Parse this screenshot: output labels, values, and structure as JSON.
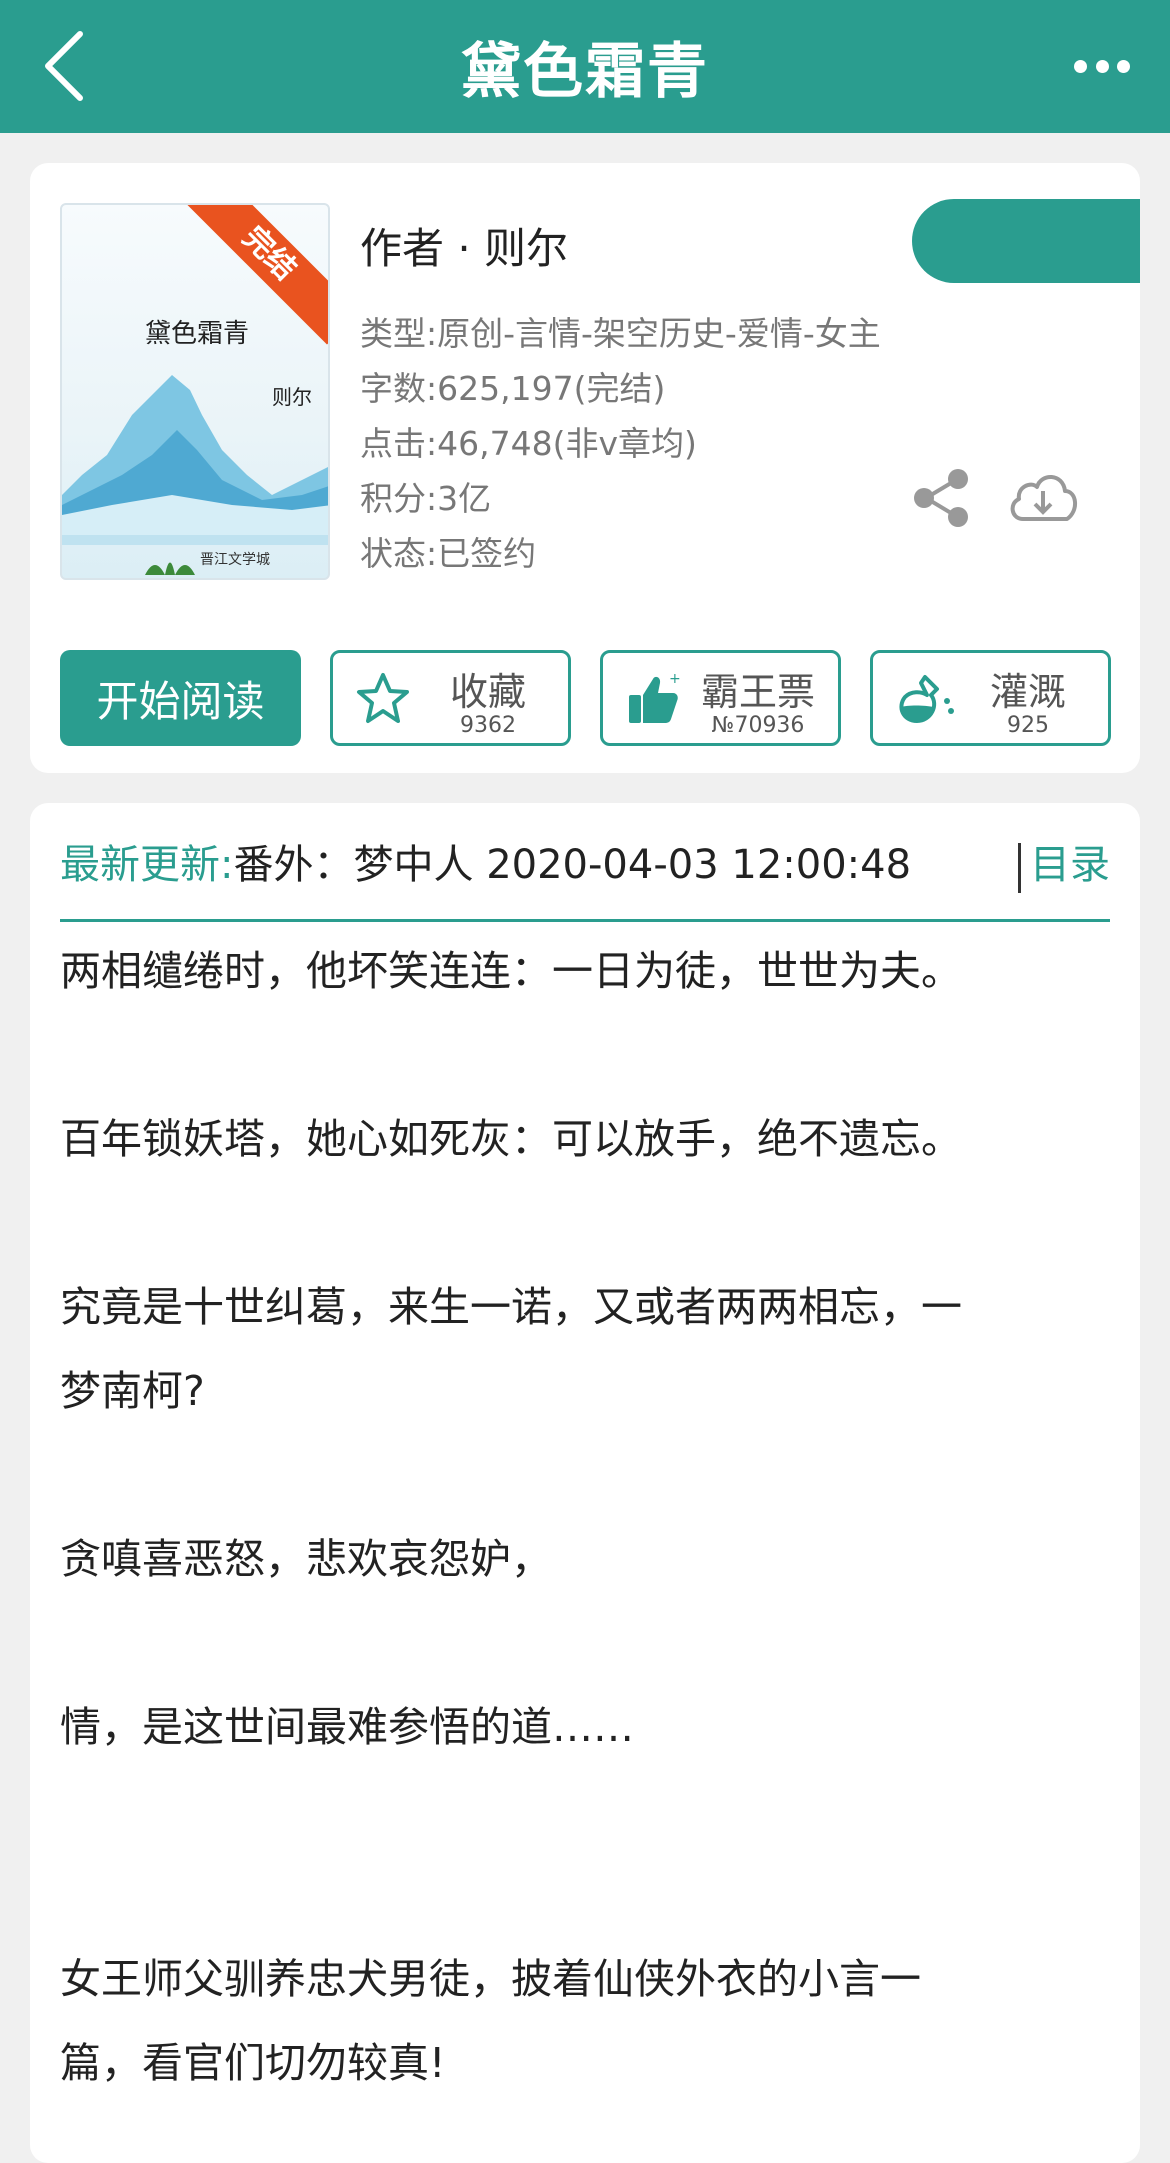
{
  "header": {
    "title": "黛色霜青",
    "back_icon": "chevron-left-icon",
    "more_icon": "more-dots-icon"
  },
  "book": {
    "cover_title": "黛色霜青",
    "cover_author": "则尔",
    "cover_badge": "完结",
    "cover_logo": "晋江文学城",
    "author_line": "作者 · 则尔",
    "meta": [
      "类型:原创-言情-架空历史-爱情-女主",
      "字数:625,197(完结)",
      "点击:46,748(非v章均)",
      "积分:3亿",
      "状态:已签约"
    ]
  },
  "actions": {
    "read_label": "开始阅读",
    "favorite": {
      "label": "收藏",
      "count": "9362",
      "icon": "star-icon"
    },
    "ticket": {
      "label": "霸王票",
      "count": "№70936",
      "icon": "thumbs-up-icon"
    },
    "water": {
      "label": "灌溉",
      "count": "925",
      "icon": "flask-icon"
    }
  },
  "update": {
    "label": "最新更新:",
    "text": "番外：梦中人 2020-04-03 12:00:48",
    "toc": "目录"
  },
  "synopsis": [
    "两相缱绻时，他坏笑连连：一日为徒，世世为夫。",
    "",
    "百年锁妖塔，她心如死灰：可以放手，绝不遗忘。",
    "",
    "究竟是十世纠葛，来生一诺，又或者两两相忘，一",
    "梦南柯?",
    "",
    "贪嗔喜恶怒，悲欢哀怨妒，",
    "",
    "情，是这世间最难参悟的道……",
    "",
    "",
    "女王师父驯养忠犬男徒，披着仙侠外衣的小言一",
    "篇，看官们切勿较真!"
  ],
  "colors": {
    "brand": "#2a9d8f",
    "badge": "#e9531f"
  }
}
